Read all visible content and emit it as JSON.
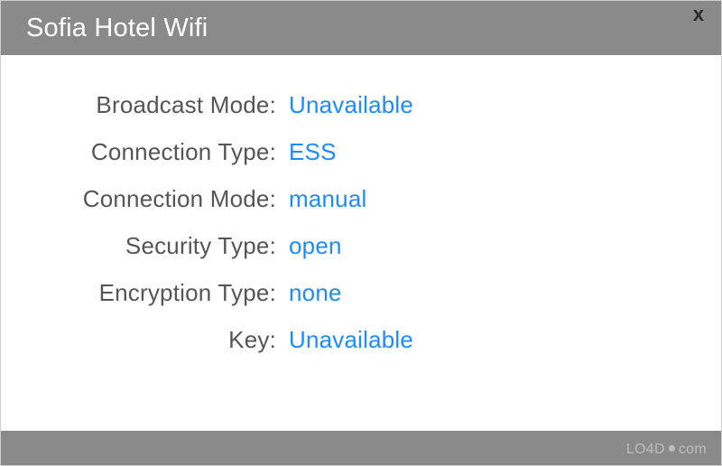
{
  "window": {
    "title": "Sofia Hotel Wifi",
    "close_label": "x"
  },
  "details": [
    {
      "label": "Broadcast Mode",
      "value": "Unavailable"
    },
    {
      "label": "Connection Type",
      "value": "ESS"
    },
    {
      "label": "Connection Mode",
      "value": "manual"
    },
    {
      "label": "Security Type",
      "value": "open"
    },
    {
      "label": "Encryption Type",
      "value": "none"
    },
    {
      "label": "Key",
      "value": "Unavailable"
    }
  ],
  "watermark": {
    "left": "LO4D",
    "right": "com"
  },
  "colors": {
    "header_bg": "#8a8a8a",
    "value_link": "#1a8cff",
    "label_text": "#555555"
  }
}
